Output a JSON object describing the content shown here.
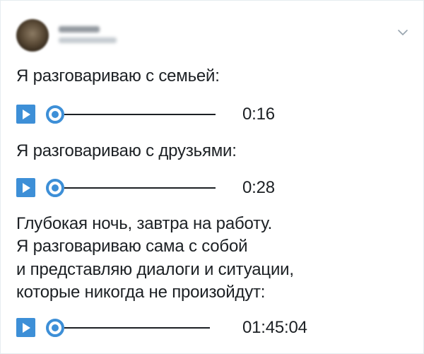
{
  "tweet": {
    "lines": {
      "family": "Я разговариваю с семьей:",
      "friends": "Я разговариваю с друзьями:",
      "night_1": "Глубокая ночь, завтра на работу.",
      "night_2": "Я разговариваю сама с собой",
      "night_3": "и представляю диалоги и ситуации,",
      "night_4": "которые никогда не произойдут:"
    },
    "audio": [
      {
        "time": "0:16"
      },
      {
        "time": "0:28"
      },
      {
        "time": "01:45:04"
      }
    ]
  },
  "icons": {
    "avatar": "avatar",
    "menu": "chevron-down-icon",
    "play": "play-icon"
  },
  "colors": {
    "accent": "#3d8fd7",
    "text": "#1c2024",
    "border": "#e6ecf0"
  }
}
